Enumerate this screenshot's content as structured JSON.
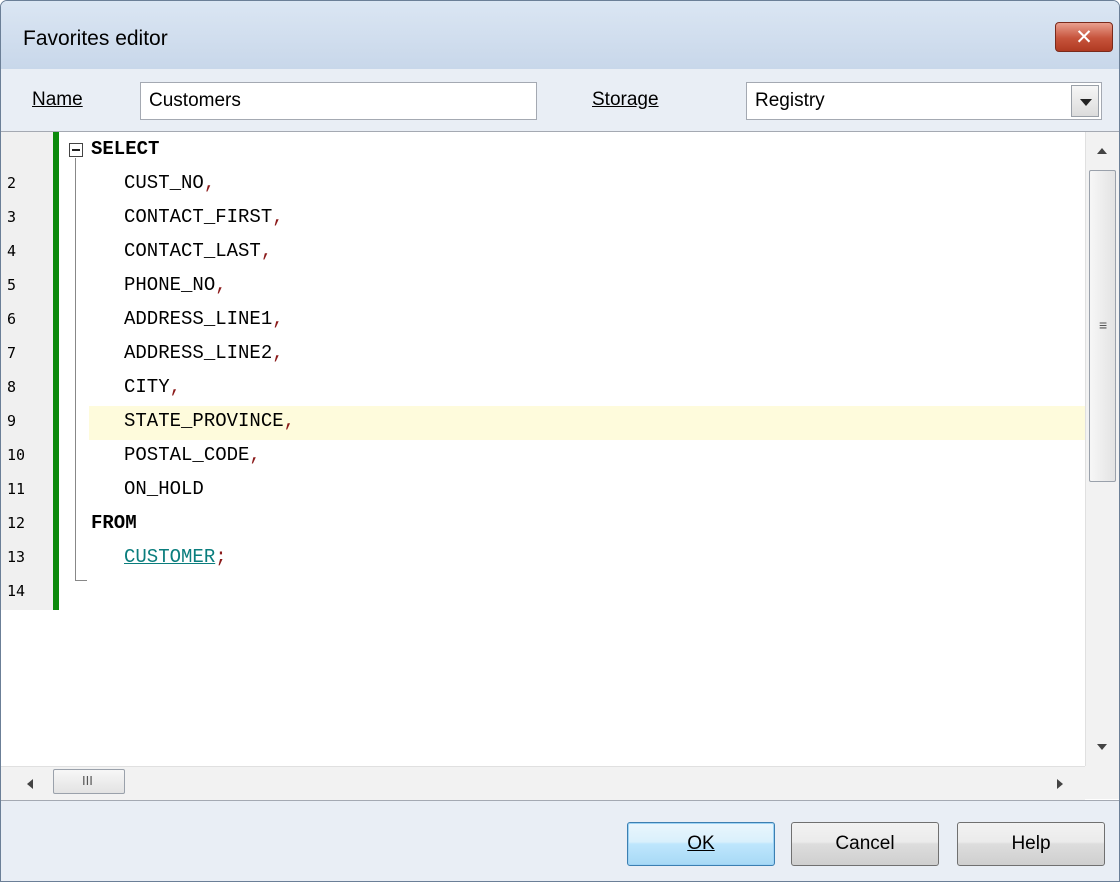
{
  "window": {
    "title": "Favorites editor",
    "close_glyph": "✕"
  },
  "form": {
    "name_label": "Name",
    "name_value": "Customers",
    "storage_label": "Storage",
    "storage_value": "Registry"
  },
  "editor": {
    "line_numbers": [
      "2",
      "3",
      "4",
      "5",
      "6",
      "7",
      "8",
      "9",
      "10",
      "11",
      "12",
      "13",
      "14"
    ],
    "lines": [
      {
        "text": "SELECT",
        "suffix": ""
      },
      {
        "text": "CUST_NO",
        "suffix": ","
      },
      {
        "text": "CONTACT_FIRST",
        "suffix": ","
      },
      {
        "text": "CONTACT_LAST",
        "suffix": ","
      },
      {
        "text": "PHONE_NO",
        "suffix": ","
      },
      {
        "text": "ADDRESS_LINE1",
        "suffix": ","
      },
      {
        "text": "ADDRESS_LINE2",
        "suffix": ","
      },
      {
        "text": "CITY",
        "suffix": ","
      },
      {
        "text": "STATE_PROVINCE",
        "suffix": ","
      },
      {
        "text": "POSTAL_CODE",
        "suffix": ","
      },
      {
        "text": "ON_HOLD",
        "suffix": ""
      },
      {
        "text": "FROM",
        "suffix": ""
      },
      {
        "text": "CUSTOMER",
        "suffix": ";"
      }
    ],
    "scroll_grip": "≡",
    "hscroll_grip": "III",
    "colors": {
      "keyword": "#000000",
      "table": "#0a7d7d",
      "punctuation": "#8b1a1a",
      "current_line": "#fefbdc",
      "modified_bar": "#0b8a0b"
    }
  },
  "buttons": {
    "ok": "OK",
    "cancel": "Cancel",
    "help": "Help"
  }
}
